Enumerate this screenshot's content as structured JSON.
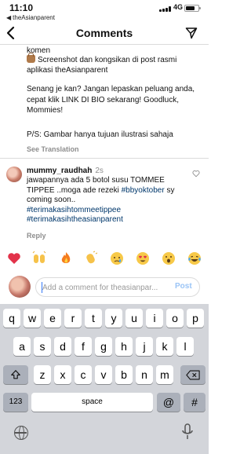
{
  "status_bar": {
    "time": "11:10",
    "back_app": "theAsianparent",
    "network": "4G"
  },
  "header": {
    "title": "Comments"
  },
  "caption": {
    "line_1": "komen",
    "line_2": "Screenshot dan kongsikan di post rasmi",
    "line_3": "aplikasi theAsianparent",
    "line_4": "Senang je kan? Jangan lepaskan peluang anda, cepat klik LINK DI BIO sekarang! Goodluck, Mommies!",
    "line_5": "P/S: Gambar hanya tujuan ilustrasi sahaja",
    "see_translation": "See Translation"
  },
  "comment": {
    "username": "mummy_raudhah",
    "time": "2s",
    "text_1": "jawapannya ada 5 botol susu TOMMEE TIPPEE ..moga ade rezeki ",
    "hashtag_1": "#bbyoktober",
    "text_2": " sy coming soon..",
    "hashtag_2": "#terimakasihtommeetippee",
    "hashtag_3": "#terimakasihtheasianparent",
    "reply_label": "Reply"
  },
  "emoji_bar": [
    "heart-emoji",
    "raised-hands-emoji",
    "fire-emoji",
    "clapping-emoji",
    "crying-face-emoji",
    "heart-eyes-emoji",
    "surprised-face-emoji",
    "laughing-tears-emoji"
  ],
  "comment_input": {
    "placeholder": "Add a comment for theasianpar...",
    "post_label": "Post"
  },
  "keyboard": {
    "row1": [
      "q",
      "w",
      "e",
      "r",
      "t",
      "y",
      "u",
      "i",
      "o",
      "p"
    ],
    "row2": [
      "a",
      "s",
      "d",
      "f",
      "g",
      "h",
      "j",
      "k",
      "l"
    ],
    "row3": [
      "z",
      "x",
      "c",
      "v",
      "b",
      "n",
      "m"
    ],
    "numbers_label": "123",
    "space_label": "space",
    "at_label": "@",
    "hash_label": "#"
  },
  "colors": {
    "hashtag": "#00376b",
    "post_disabled": "#9ac4f6",
    "keyboard_bg": "#d3d5da",
    "muted_text": "#8e8e8e"
  }
}
